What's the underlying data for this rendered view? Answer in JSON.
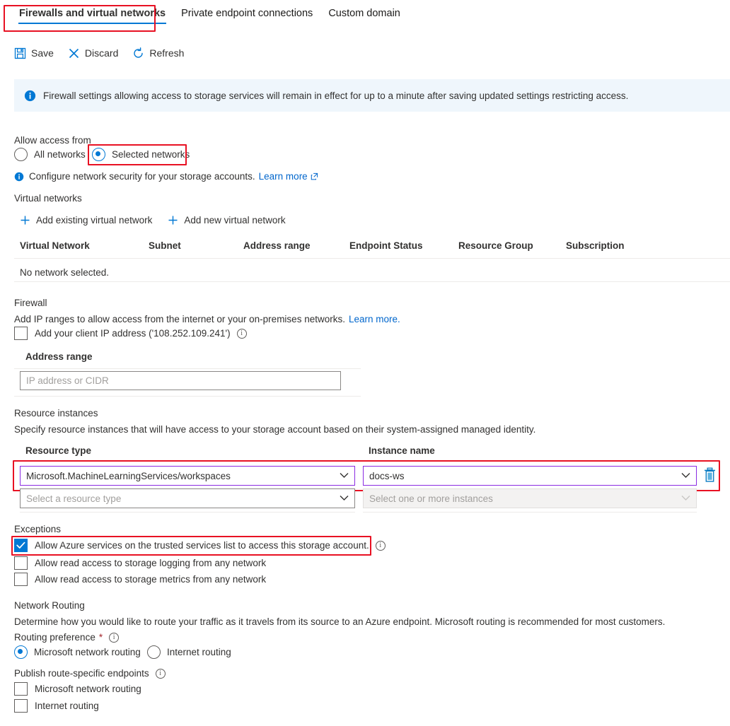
{
  "tabs": [
    {
      "label": "Firewalls and virtual networks",
      "active": true
    },
    {
      "label": "Private endpoint connections",
      "active": false
    },
    {
      "label": "Custom domain",
      "active": false
    }
  ],
  "toolbar": {
    "save_label": "Save",
    "discard_label": "Discard",
    "refresh_label": "Refresh"
  },
  "banner": {
    "text": "Firewall settings allowing access to storage services will remain in effect for up to a minute after saving updated settings restricting access."
  },
  "allow_access": {
    "title": "Allow access from",
    "options": [
      {
        "label": "All networks",
        "selected": false
      },
      {
        "label": "Selected networks",
        "selected": true
      }
    ],
    "note": "Configure network security for your storage accounts.",
    "note_link": "Learn more"
  },
  "virtual_networks": {
    "title": "Virtual networks",
    "actions": [
      {
        "label": "Add existing virtual network"
      },
      {
        "label": "Add new virtual network"
      }
    ],
    "columns": [
      "Virtual Network",
      "Subnet",
      "Address range",
      "Endpoint Status",
      "Resource Group",
      "Subscription"
    ],
    "empty_text": "No network selected.",
    "rows": []
  },
  "firewall": {
    "title": "Firewall",
    "description": "Add IP ranges to allow access from the internet or your on-premises networks.",
    "description_link": "Learn more.",
    "client_ip_checkbox": {
      "label": "Add your client IP address ('108.252.109.241')",
      "checked": false
    },
    "address_range_label": "Address range",
    "address_range_placeholder": "IP address or CIDR",
    "address_range_value": ""
  },
  "resource_instances": {
    "title": "Resource instances",
    "description": "Specify resource instances that will have access to your storage account based on their system-assigned managed identity.",
    "col_resource_type": "Resource type",
    "col_instance_name": "Instance name",
    "rows": [
      {
        "resource_type": "Microsoft.MachineLearningServices/workspaces",
        "instance_name": "docs-ws",
        "highlighted": true,
        "disabled": false,
        "delete_icon": "trash-icon"
      },
      {
        "resource_type": "Select a resource type",
        "instance_name": "Select one or more instances",
        "highlighted": false,
        "disabled": true,
        "delete_icon": ""
      }
    ]
  },
  "exceptions": {
    "title": "Exceptions",
    "items": [
      {
        "label": "Allow Azure services on the trusted services list to access this storage account.",
        "checked": true,
        "has_info": true,
        "highlighted": true
      },
      {
        "label": "Allow read access to storage logging from any network",
        "checked": false,
        "has_info": false,
        "highlighted": false
      },
      {
        "label": "Allow read access to storage metrics from any network",
        "checked": false,
        "has_info": false,
        "highlighted": false
      }
    ]
  },
  "network_routing": {
    "title": "Network Routing",
    "description": "Determine how you would like to route your traffic as it travels from its source to an Azure endpoint. Microsoft routing is recommended for most customers.",
    "routing_preference_label": "Routing preference",
    "required_marker": "*",
    "routing_options": [
      {
        "label": "Microsoft network routing",
        "selected": true
      },
      {
        "label": "Internet routing",
        "selected": false
      }
    ],
    "publish_label": "Publish route-specific endpoints",
    "publish_options": [
      {
        "label": "Microsoft network routing",
        "checked": false
      },
      {
        "label": "Internet routing",
        "checked": false
      }
    ]
  },
  "colors": {
    "accent": "#0078d4",
    "highlight": "#e81123",
    "focus_border": "#8a2be2",
    "banner_bg": "#eff6fc",
    "link": "#0066cc"
  }
}
